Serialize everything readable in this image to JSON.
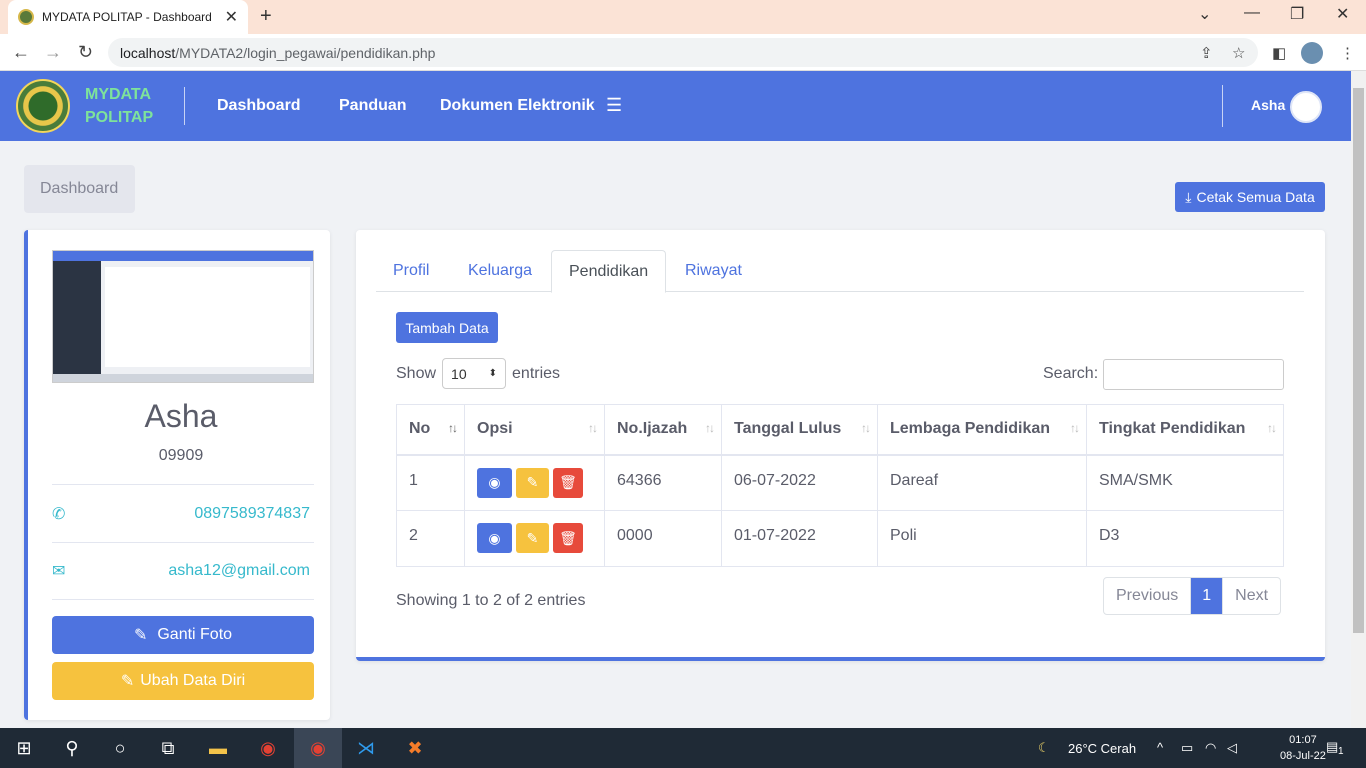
{
  "browser": {
    "tab_title": "MYDATA POLITAP - Dashboard",
    "url_host": "localhost",
    "url_path": "/MYDATA2/login_pegawai/pendidikan.php"
  },
  "navbar": {
    "brand_line1": "MYDATA",
    "brand_line2": "POLITAP",
    "links": [
      "Dashboard",
      "Panduan",
      "Dokumen Elektronik"
    ],
    "user": "Asha"
  },
  "breadcrumb": "Dashboard",
  "print_button": "Cetak Semua Data",
  "profile": {
    "name": "Asha",
    "nip": "09909",
    "phone": "0897589374837",
    "email": "asha12@gmail.com",
    "btn_photo": "Ganti Foto",
    "btn_edit": "Ubah Data Diri"
  },
  "tabs": [
    "Profil",
    "Keluarga",
    "Pendidikan",
    "Riwayat"
  ],
  "active_tab": "Pendidikan",
  "add_button": "Tambah Data",
  "table_controls": {
    "show_label": "Show",
    "entries_value": "10",
    "entries_label": "entries",
    "search_label": "Search:"
  },
  "table": {
    "headers": [
      "No",
      "Opsi",
      "No.Ijazah",
      "Tanggal Lulus",
      "Lembaga Pendidikan",
      "Tingkat Pendidikan"
    ],
    "rows": [
      {
        "no": "1",
        "ijazah": "64366",
        "tanggal": "06-07-2022",
        "lembaga": "Dareaf",
        "tingkat": "SMA/SMK"
      },
      {
        "no": "2",
        "ijazah": "0000",
        "tanggal": "01-07-2022",
        "lembaga": "Poli",
        "tingkat": "D3"
      }
    ]
  },
  "info": "Showing 1 to 2 of 2 entries",
  "pager": {
    "prev": "Previous",
    "current": "1",
    "next": "Next"
  },
  "taskbar": {
    "weather": "26°C  Cerah",
    "time": "01:07",
    "date": "08-Jul-22",
    "notif_count": "1"
  },
  "colors": {
    "primary": "#4e73df",
    "warning": "#f6c23e",
    "danger": "#e74a3b",
    "info": "#36b9cc"
  }
}
